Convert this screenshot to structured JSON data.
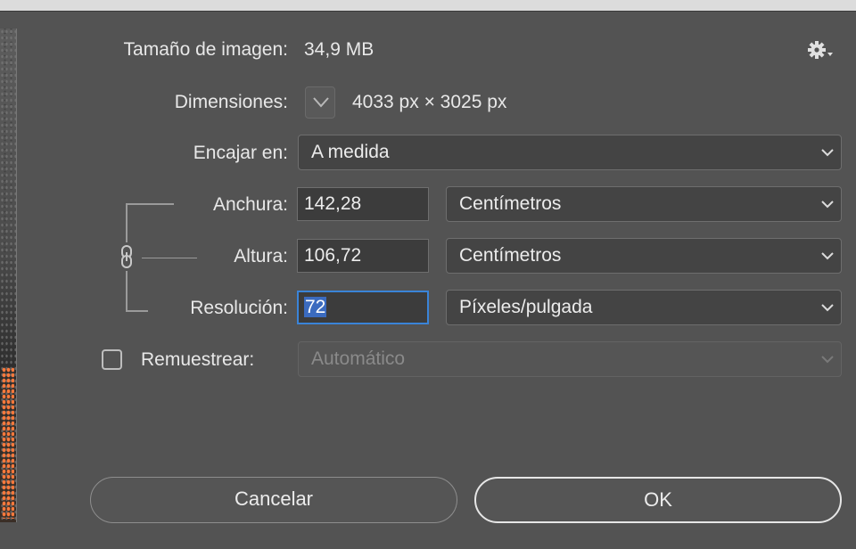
{
  "dialog": {
    "image_size_label": "Tamaño de imagen:",
    "image_size_value": "34,9 MB",
    "dimensions_label": "Dimensiones:",
    "dimensions_value": "4033 px × 3025 px",
    "fit_to_label": "Encajar en:",
    "fit_to_value": "A medida",
    "width_label": "Anchura:",
    "width_value": "142,28",
    "width_unit": "Centímetros",
    "height_label": "Altura:",
    "height_value": "106,72",
    "height_unit": "Centímetros",
    "resolution_label": "Resolución:",
    "resolution_value": "72",
    "resolution_unit": "Píxeles/pulgada",
    "resample_label": "Remuestrear:",
    "resample_checked": false,
    "resample_value": "Automático",
    "cancel_label": "Cancelar",
    "ok_label": "OK"
  },
  "icons": {
    "settings": "gear-icon",
    "dimensions_toggle": "chevron-down-icon",
    "constrain": "link-icon"
  },
  "colors": {
    "background": "#535353",
    "field": "#444444",
    "focus_ring": "#3a84d8",
    "selection": "#3b6bbf"
  }
}
